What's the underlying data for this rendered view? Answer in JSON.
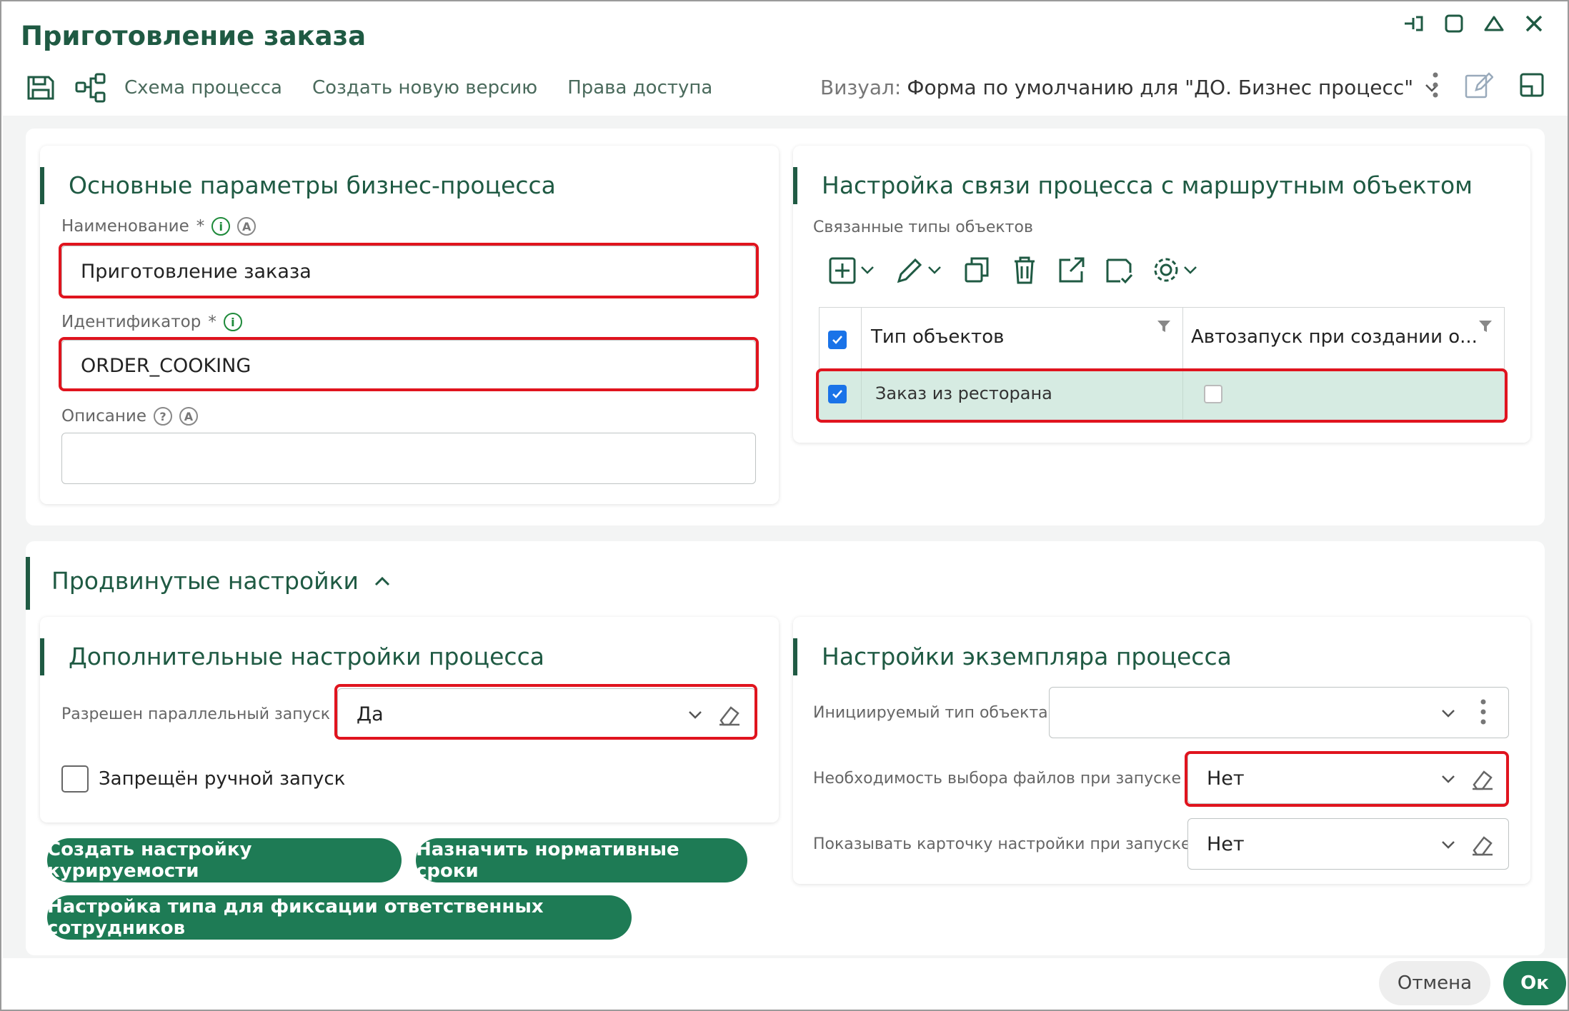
{
  "window": {
    "title": "Приготовление заказа"
  },
  "toolbar": {
    "process_scheme": "Схема процесса",
    "new_version": "Создать новую версию",
    "access_rights": "Права доступа",
    "visual_label": "Визуал:",
    "visual_value": "Форма по умолчанию для \"ДО. Бизнес процесс\""
  },
  "basic": {
    "title": "Основные параметры бизнес-процесса",
    "name_label": "Наименование",
    "name_value": "Приготовление заказа",
    "id_label": "Идентификатор",
    "id_value": "ORDER_COOKING",
    "desc_label": "Описание",
    "desc_value": "",
    "required_mark": "*"
  },
  "route": {
    "title": "Настройка связи процесса с маршрутным объектом",
    "linked_label": "Связанные типы объектов",
    "columns": [
      "Тип объектов",
      "Автозапуск при создании о..."
    ],
    "rows": [
      {
        "type": "Заказ из ресторана",
        "autostart": false,
        "selected": true
      }
    ]
  },
  "advanced": {
    "title": "Продвинутые настройки"
  },
  "extra": {
    "title": "Дополнительные настройки процесса",
    "parallel_label": "Разрешен параллельный запуск",
    "parallel_value": "Да",
    "manual_label": "Запрещён ручной запуск",
    "manual_checked": false
  },
  "instance": {
    "title": "Настройки экземпляра процесса",
    "init_type_label": "Инициируемый тип объекта",
    "init_type_value": "",
    "files_label": "Необходимость выбора файлов при запуске",
    "files_value": "Нет",
    "card_label": "Показывать карточку настройки при запуске",
    "card_value": "Нет"
  },
  "buttons": {
    "curation": "Создать настройку курируемости",
    "deadlines": "Назначить нормативные сроки",
    "responsible": "Настройка типа для фиксации ответственных сотрудников",
    "cancel": "Отмена",
    "ok": "Ок"
  },
  "colors": {
    "brand": "#1f5a43",
    "button": "#1e7b55",
    "highlight": "#e0141e",
    "selected_row": "#d6ebe2",
    "checkbox": "#1a73e8"
  }
}
